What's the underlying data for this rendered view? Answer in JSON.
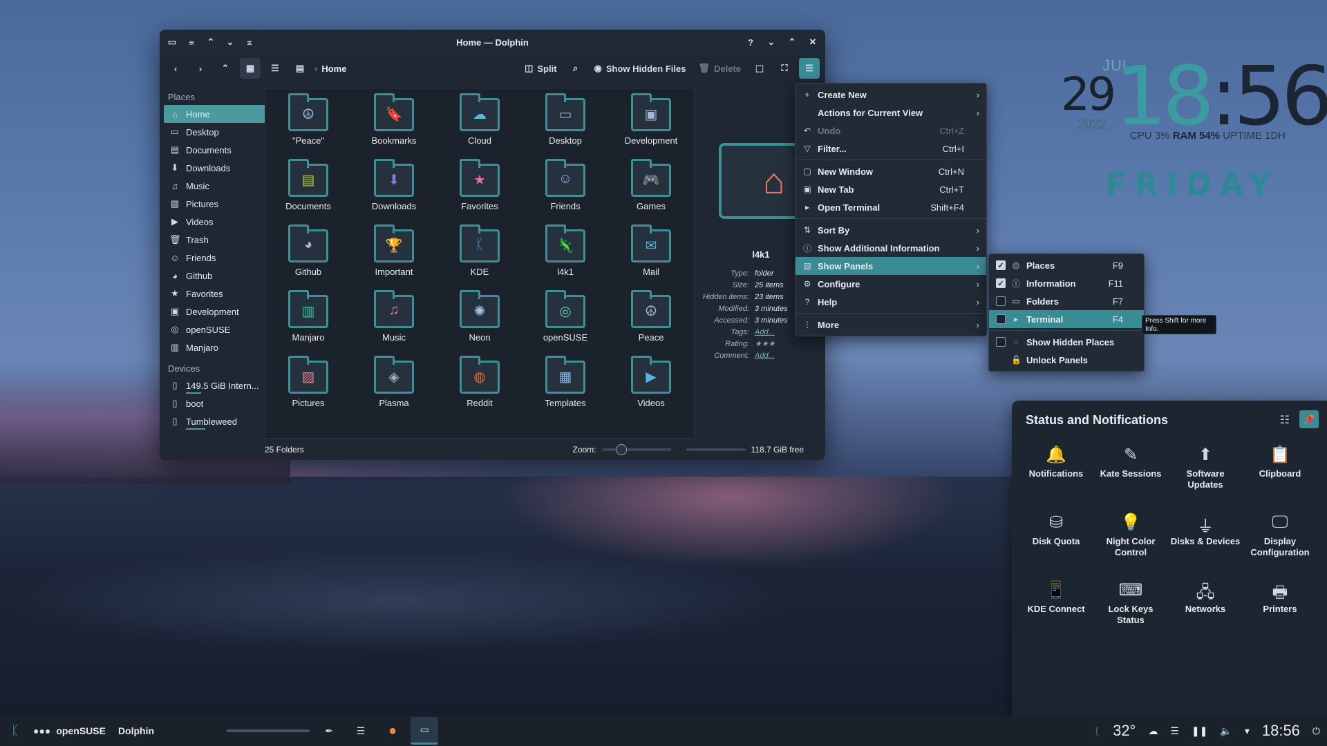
{
  "window": {
    "title": "Home — Dolphin",
    "toolbar": {
      "breadcrumb": "Home",
      "split_label": "Split",
      "hidden_files_label": "Show Hidden Files",
      "delete_label": "Delete"
    },
    "places": {
      "section_places": "Places",
      "items": [
        {
          "label": "Home",
          "icon": "home-icon"
        },
        {
          "label": "Desktop",
          "icon": "desktop-icon"
        },
        {
          "label": "Documents",
          "icon": "documents-icon"
        },
        {
          "label": "Downloads",
          "icon": "downloads-icon"
        },
        {
          "label": "Music",
          "icon": "music-icon"
        },
        {
          "label": "Pictures",
          "icon": "pictures-icon"
        },
        {
          "label": "Videos",
          "icon": "videos-icon"
        },
        {
          "label": "Trash",
          "icon": "trash-icon"
        },
        {
          "label": "Friends",
          "icon": "friends-icon"
        },
        {
          "label": "Github",
          "icon": "github-icon"
        },
        {
          "label": "Favorites",
          "icon": "star-icon"
        },
        {
          "label": "Development",
          "icon": "development-icon"
        },
        {
          "label": "openSUSE",
          "icon": "opensuse-icon"
        },
        {
          "label": "Manjaro",
          "icon": "manjaro-icon"
        }
      ],
      "section_devices": "Devices",
      "devices": [
        {
          "label": "149.5 GiB Intern...",
          "usage": 0.2
        },
        {
          "label": "boot",
          "usage": 0.0
        },
        {
          "label": "Tumbleweed",
          "usage": 0.25
        }
      ]
    },
    "folders": [
      {
        "name": "\"Peace\"",
        "icon": "peace-icon"
      },
      {
        "name": "Bookmarks",
        "icon": "bookmarks-icon"
      },
      {
        "name": "Cloud",
        "icon": "cloud-icon"
      },
      {
        "name": "Desktop",
        "icon": "desktop-icon"
      },
      {
        "name": "Development",
        "icon": "development-icon"
      },
      {
        "name": "Documents",
        "icon": "documents-icon"
      },
      {
        "name": "Downloads",
        "icon": "downloads-icon"
      },
      {
        "name": "Favorites",
        "icon": "star-icon"
      },
      {
        "name": "Friends",
        "icon": "friends-icon"
      },
      {
        "name": "Games",
        "icon": "gamepad-icon"
      },
      {
        "name": "Github",
        "icon": "github-icon"
      },
      {
        "name": "Important",
        "icon": "trophy-icon"
      },
      {
        "name": "KDE",
        "icon": "kde-icon"
      },
      {
        "name": "l4k1",
        "icon": "chameleon-icon"
      },
      {
        "name": "Mail",
        "icon": "mail-icon"
      },
      {
        "name": "Manjaro",
        "icon": "manjaro-icon"
      },
      {
        "name": "Music",
        "icon": "music-icon"
      },
      {
        "name": "Neon",
        "icon": "neon-icon"
      },
      {
        "name": "openSUSE",
        "icon": "opensuse-icon"
      },
      {
        "name": "Peace",
        "icon": "peace-icon"
      },
      {
        "name": "Pictures",
        "icon": "pictures-icon"
      },
      {
        "name": "Plasma",
        "icon": "plasma-icon"
      },
      {
        "name": "Reddit",
        "icon": "reddit-icon"
      },
      {
        "name": "Templates",
        "icon": "templates-icon"
      },
      {
        "name": "Videos",
        "icon": "videos-icon"
      }
    ],
    "statusbar": {
      "count": "25 Folders",
      "zoom_label": "Zoom:",
      "free": "118.7 GiB free",
      "disk_used_fraction": 0.2
    },
    "info_panel": {
      "name": "l4k1",
      "rows": [
        {
          "k": "Type:",
          "v": "folder"
        },
        {
          "k": "Size:",
          "v": "25 items"
        },
        {
          "k": "Hidden items:",
          "v": "23 items"
        },
        {
          "k": "Modified:",
          "v": "3 minutes"
        },
        {
          "k": "Accessed:",
          "v": "3 minutes"
        },
        {
          "k": "Tags:",
          "v": "Add..."
        },
        {
          "k": "Rating:",
          "v": "★★★"
        },
        {
          "k": "Comment:",
          "v": "Add..."
        }
      ]
    }
  },
  "main_menu": [
    {
      "label": "Create New",
      "icon": "plus-icon",
      "shortcut": "",
      "submenu": true
    },
    {
      "label": "Actions for Current View",
      "icon": "",
      "shortcut": "",
      "submenu": true
    },
    {
      "label": "Undo",
      "icon": "undo-icon",
      "shortcut": "Ctrl+Z",
      "disabled": true
    },
    {
      "label": "Filter...",
      "icon": "filter-icon",
      "shortcut": "Ctrl+I"
    },
    {
      "label": "New Window",
      "icon": "window-icon",
      "shortcut": "Ctrl+N"
    },
    {
      "label": "New Tab",
      "icon": "tab-icon",
      "shortcut": "Ctrl+T"
    },
    {
      "label": "Open Terminal",
      "icon": "terminal-icon",
      "shortcut": "Shift+F4"
    },
    {
      "label": "Sort By",
      "icon": "sort-icon",
      "shortcut": "",
      "submenu": true
    },
    {
      "label": "Show Additional Information",
      "icon": "info-icon",
      "shortcut": "",
      "submenu": true
    },
    {
      "label": "Show Panels",
      "icon": "panels-icon",
      "shortcut": "",
      "submenu": true
    },
    {
      "label": "Configure",
      "icon": "configure-icon",
      "shortcut": "",
      "submenu": true
    },
    {
      "label": "Help",
      "icon": "help-icon",
      "shortcut": "",
      "submenu": true
    },
    {
      "label": "More",
      "icon": "more-icon",
      "shortcut": "",
      "submenu": true
    }
  ],
  "panels_menu": [
    {
      "label": "Places",
      "shortcut": "F9",
      "checked": true
    },
    {
      "label": "Information",
      "shortcut": "F11",
      "checked": true
    },
    {
      "label": "Folders",
      "shortcut": "F7",
      "checked": false
    },
    {
      "label": "Terminal",
      "shortcut": "F4",
      "checked": false
    },
    {
      "label": "Show Hidden Places",
      "shortcut": "",
      "checked": false
    },
    {
      "label": "Unlock Panels",
      "shortcut": ""
    }
  ],
  "tooltip": "Press Shift for more Info.",
  "clock": {
    "month": "JUL",
    "day": "29",
    "year": "2022",
    "time_h": "18",
    "time_sep": ":",
    "time_m": "56",
    "cpu": "CPU 3%",
    "ram": "RAM 54%",
    "uptime": "UPTIME 1DH",
    "weekday": "FRIDAY"
  },
  "status_notifications": {
    "title": "Status and Notifications",
    "items": [
      {
        "label": "Notifications",
        "icon": "bell-icon"
      },
      {
        "label": "Kate Sessions",
        "icon": "kate-icon"
      },
      {
        "label": "Software Updates",
        "icon": "updates-icon"
      },
      {
        "label": "Clipboard",
        "icon": "clipboard-icon"
      },
      {
        "label": "Disk Quota",
        "icon": "disk-quota-icon"
      },
      {
        "label": "Night Color Control",
        "icon": "bulb-icon"
      },
      {
        "label": "Disks & Devices",
        "icon": "usb-icon"
      },
      {
        "label": "Display Configuration",
        "icon": "display-icon"
      },
      {
        "label": "KDE Connect",
        "icon": "phone-icon"
      },
      {
        "label": "Lock Keys Status",
        "icon": "keyboard-icon"
      },
      {
        "label": "Networks",
        "icon": "network-icon"
      },
      {
        "label": "Printers",
        "icon": "printer-icon"
      }
    ]
  },
  "taskbar": {
    "activity": "openSUSE",
    "app": "Dolphin",
    "temperature": "32°",
    "time": "18:56"
  },
  "colors": {
    "accent": "#3a8c94",
    "window_bg": "#1f2733",
    "panel_bg": "#1d2530"
  }
}
